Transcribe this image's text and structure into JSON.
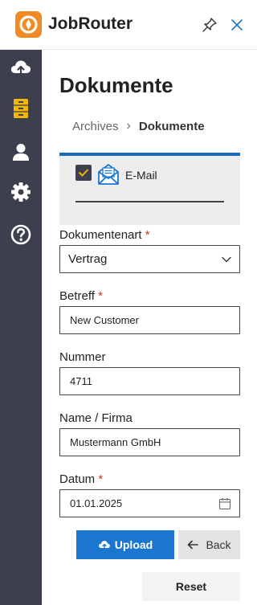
{
  "app": {
    "title": "JobRouter"
  },
  "colors": {
    "accent": "#1b76cf",
    "sidebar": "#3c3f4e",
    "logo": "#f08a24",
    "required": "#c0392b",
    "close": "#1b76cf"
  },
  "titlebar": {
    "icons": [
      "pin-icon",
      "close-icon"
    ]
  },
  "sidebar": {
    "items": [
      {
        "icon": "cloud-upload-icon"
      },
      {
        "icon": "archive-icon",
        "active": true
      },
      {
        "icon": "user-icon"
      },
      {
        "icon": "gear-icon"
      },
      {
        "icon": "help-icon"
      }
    ]
  },
  "page": {
    "title": "Dokumente"
  },
  "breadcrumb": {
    "items": [
      "Archives",
      "Dokumente"
    ],
    "separator": "›"
  },
  "email_option": {
    "label": "E-Mail",
    "checked": true,
    "icon": "envelope-icon"
  },
  "form": {
    "doc_type": {
      "label": "Dokumentenart",
      "required": "*",
      "value": "Vertrag"
    },
    "subject": {
      "label": "Betreff",
      "required": "*",
      "value": "New Customer"
    },
    "number": {
      "label": "Nummer",
      "value": "4711"
    },
    "name": {
      "label": "Name / Firma",
      "value": "Mustermann GmbH"
    },
    "date": {
      "label": "Datum",
      "required": "*",
      "value": "01.01.2025"
    }
  },
  "buttons": {
    "upload": "Upload",
    "back": "Back",
    "reset": "Reset"
  }
}
